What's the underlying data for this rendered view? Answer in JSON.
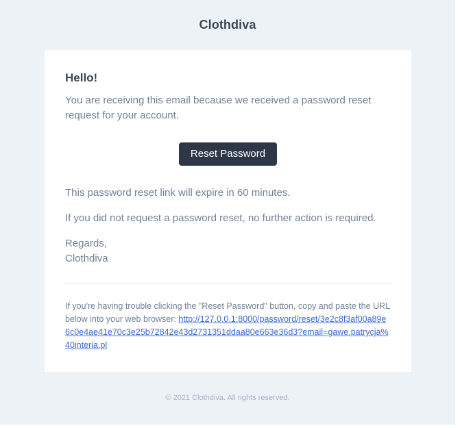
{
  "header": {
    "brand": "Clothdiva"
  },
  "content": {
    "greeting": "Hello!",
    "intro": "You are receiving this email because we received a password reset request for your account.",
    "button_label": "Reset Password",
    "expire_notice": "This password reset link will expire in 60 minutes.",
    "no_action_notice": "If you did not request a password reset, no further action is required.",
    "regards_label": "Regards,",
    "regards_name": "Clothdiva",
    "subcopy_text": "If you're having trouble clicking the \"Reset Password\" button, copy and paste the URL below into your web browser:",
    "reset_url": "http://127.0.0.1:8000/password/reset/3e2c8f3af00a89e6c0e4ae41e70c3e25b72842e43d2731351ddaa80e663e36d3?email=gawe.patrycja%40interia.pl"
  },
  "footer": {
    "copyright": "© 2021 Clothdiva. All rights reserved."
  }
}
